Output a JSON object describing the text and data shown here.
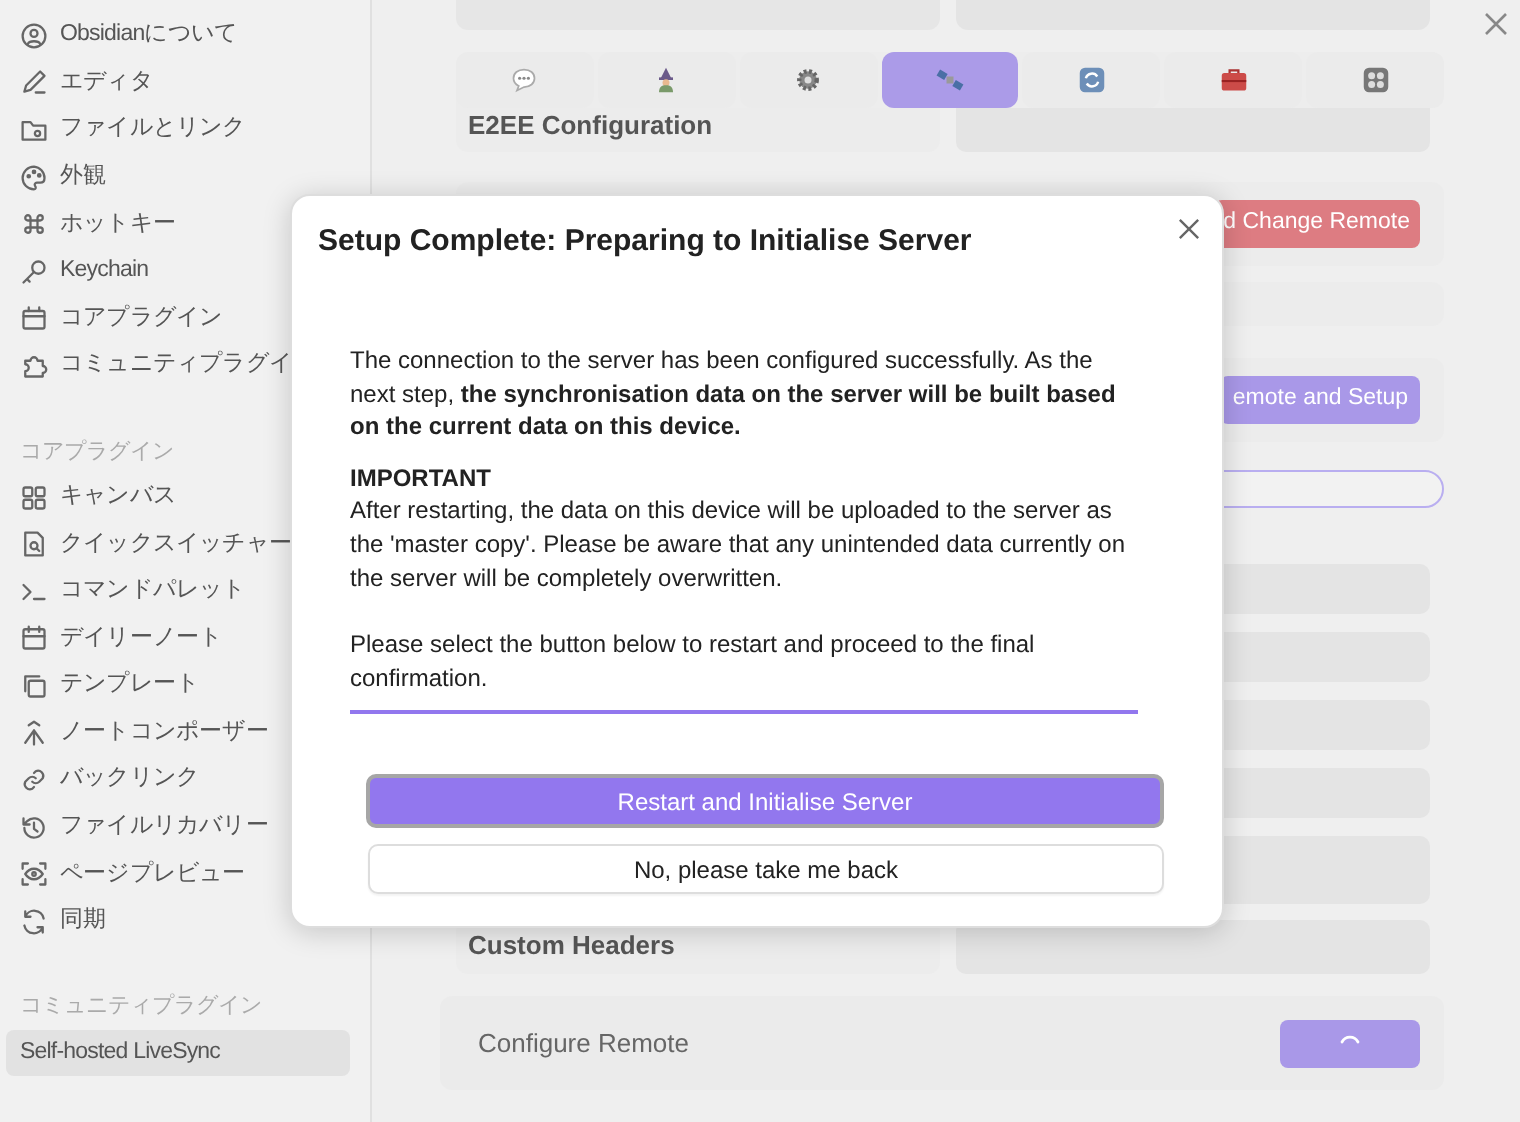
{
  "sidebar": {
    "groups": [
      {
        "items": [
          {
            "label": "Obsidianについて",
            "selected": false
          },
          {
            "label": "エディタ",
            "selected": false
          },
          {
            "label": "ファイルとリンク",
            "selected": false
          },
          {
            "label": "外観",
            "selected": false
          },
          {
            "label": "ホットキー",
            "selected": false
          },
          {
            "label": "Keychain",
            "selected": false
          },
          {
            "label": "コアプラグイン",
            "selected": false
          },
          {
            "label": "コミュニティプラグイ",
            "selected": false
          }
        ]
      },
      {
        "header": "コアプラグイン",
        "items": [
          {
            "label": "キャンバス",
            "selected": false
          },
          {
            "label": "クイックスイッチャー",
            "selected": false
          },
          {
            "label": "コマンドパレット",
            "selected": false
          },
          {
            "label": "デイリーノート",
            "selected": false
          },
          {
            "label": "テンプレート",
            "selected": false
          },
          {
            "label": "ノートコンポーザー",
            "selected": false
          },
          {
            "label": "バックリンク",
            "selected": false
          },
          {
            "label": "ファイルリカバリー",
            "selected": false
          },
          {
            "label": "ページプレビュー",
            "selected": false
          },
          {
            "label": "同期",
            "selected": false
          }
        ]
      },
      {
        "header": "コミュニティプラグイン",
        "items": [
          {
            "label": "Self-hosted LiveSync",
            "selected": true
          }
        ]
      }
    ]
  },
  "tabs": [
    {
      "selected": false
    },
    {
      "selected": false
    },
    {
      "selected": false
    },
    {
      "selected": true
    },
    {
      "selected": false
    },
    {
      "selected": false
    },
    {
      "selected": false
    }
  ],
  "settings": {
    "e2ee_heading": "E2EE Configuration",
    "danger_button": "d Change Remote",
    "setup_button": "emote and Setup",
    "custom_headers_heading": "Custom Headers",
    "configure_remote": {
      "label": "Configure Remote",
      "loading": true
    }
  },
  "modal": {
    "title": "Setup Complete: Preparing to Initialise Server",
    "paragraphs": [
      {
        "kind": "text",
        "text": "The connection to the server has been configured successfully. As the next step, **the synchronisation data on the server will be built based on the current data on this device.**"
      },
      {
        "kind": "heading",
        "text": "IMPORTANT"
      },
      {
        "kind": "text",
        "text": "After restarting, the data on this device will be uploaded to the server as the 'master copy'. Please be aware that any unintended data currently on the server will be completely overwritten."
      },
      {
        "kind": "gap"
      },
      {
        "kind": "text",
        "text": "Please select the button below to restart and proceed to the final confirmation."
      }
    ],
    "buttons": [
      {
        "label": "Restart and Initialise Server",
        "primary": true
      },
      {
        "label": "No, please take me back",
        "primary": false
      }
    ]
  }
}
